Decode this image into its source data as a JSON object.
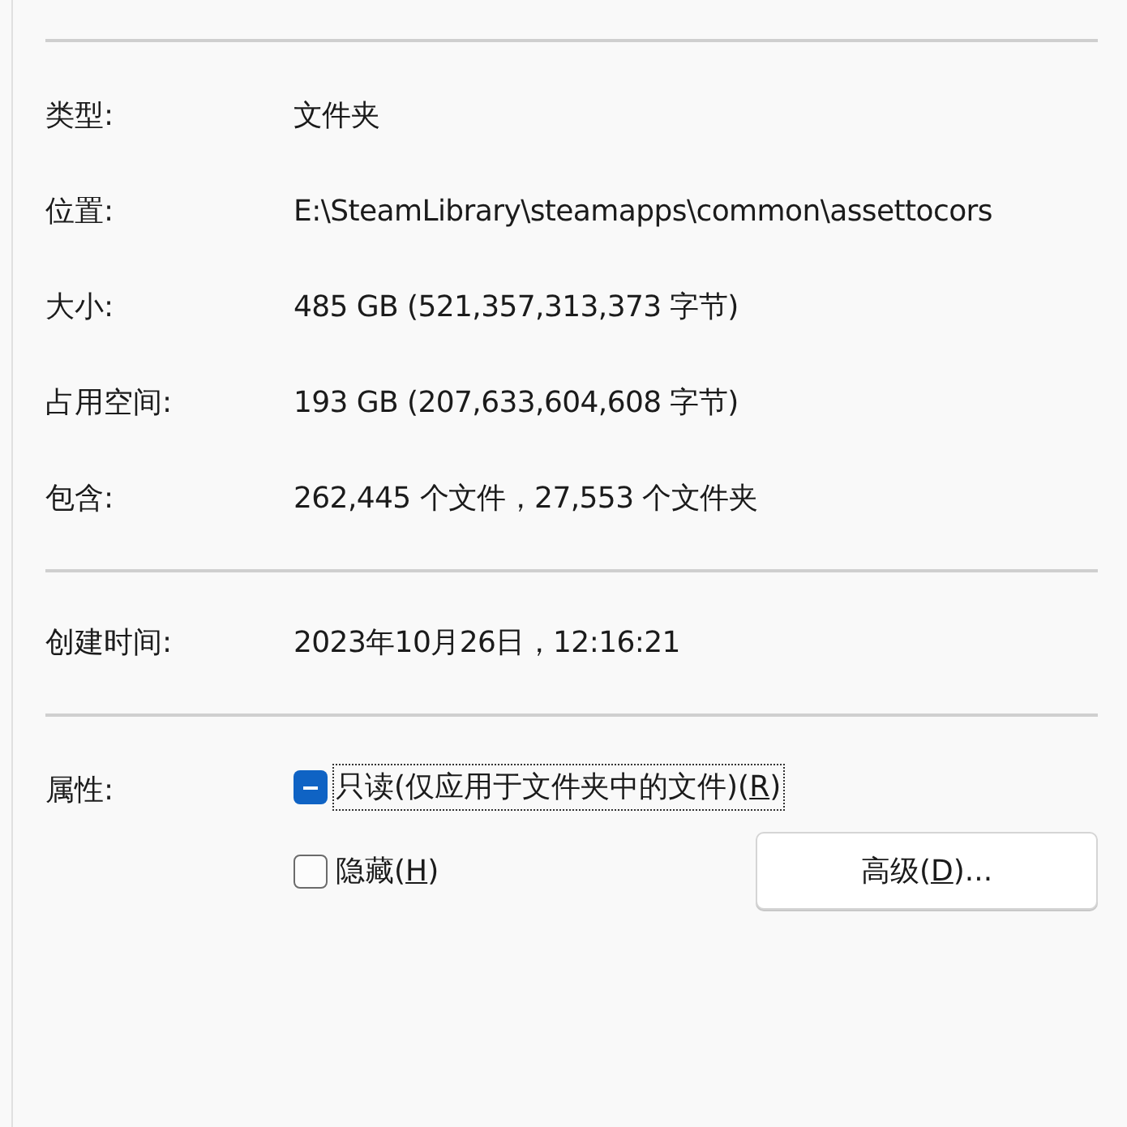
{
  "properties": [
    {
      "label": "类型:",
      "value": "文件夹"
    },
    {
      "label": "位置:",
      "value": "E:\\SteamLibrary\\steamapps\\common\\assettocors"
    },
    {
      "label": "大小:",
      "value": "485 GB (521,357,313,373 字节)"
    },
    {
      "label": "占用空间:",
      "value": "193 GB (207,633,604,608 字节)"
    },
    {
      "label": "包含:",
      "value": "262,445 个文件，27,553 个文件夹"
    }
  ],
  "created": {
    "label": "创建时间:",
    "value": "2023年10月26日，12:16:21"
  },
  "attributes": {
    "label": "属性:",
    "checkboxes": [
      {
        "label": "只读(仅应用于文件夹中的文件)(",
        "accesskey": "R",
        "label_end": ")",
        "indeterminate": true,
        "focused": true
      },
      {
        "label": "隐藏(",
        "accesskey": "H",
        "label_end": ")",
        "indeterminate": false,
        "focused": false
      }
    ],
    "advanced_button": {
      "label": "高级(",
      "accesskey": "D",
      "label_end": ")..."
    }
  }
}
